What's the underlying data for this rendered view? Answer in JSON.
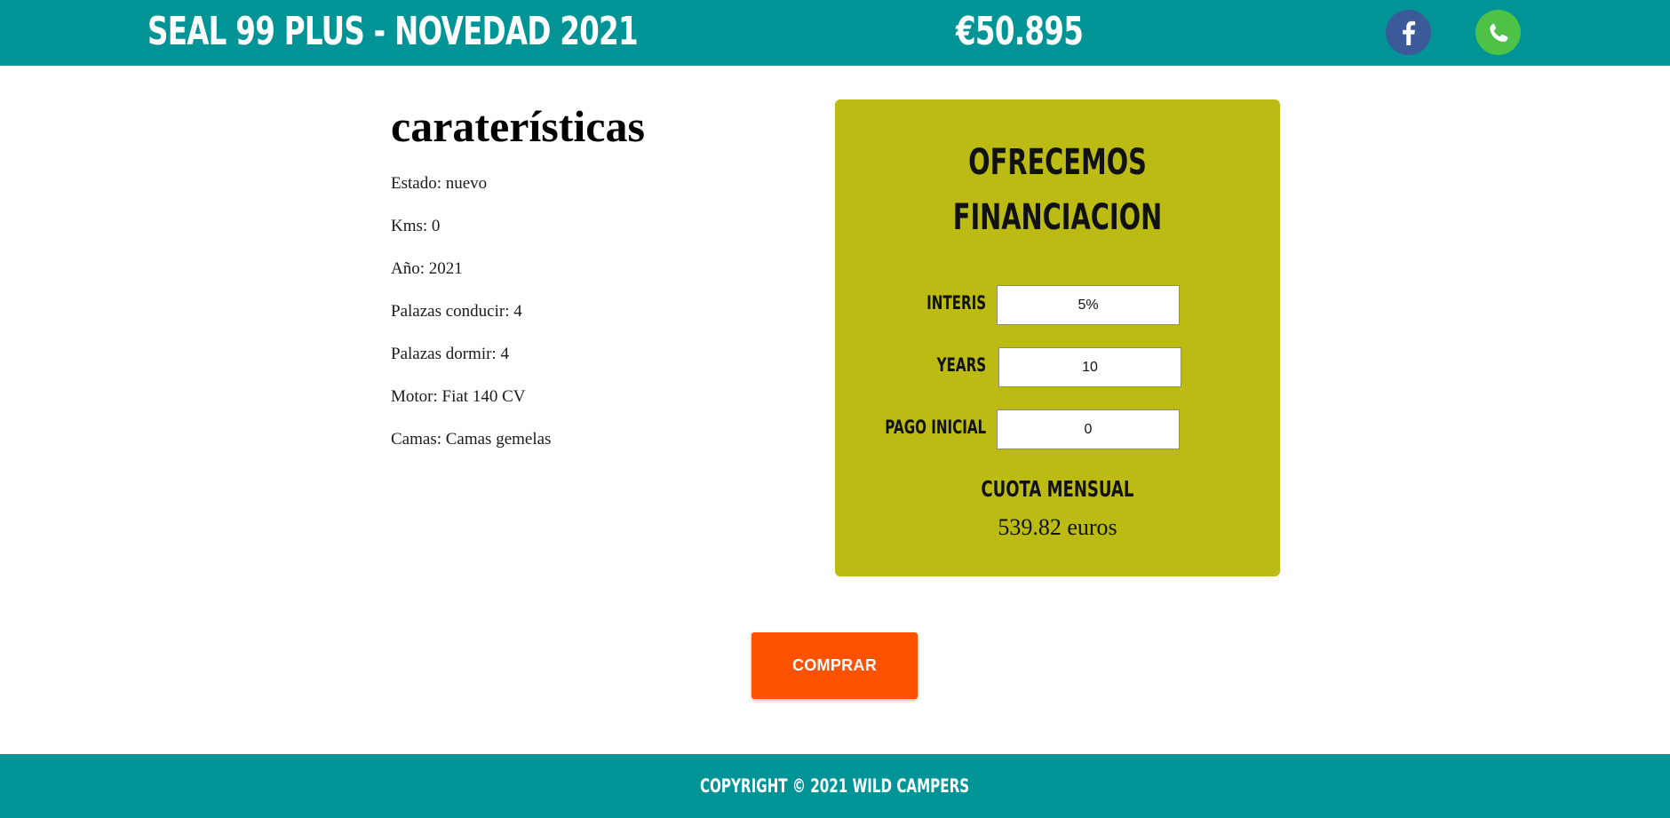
{
  "header": {
    "title": "SEAL 99 PLUS - NOVEDAD 2021",
    "price": "€50.895",
    "social": [
      {
        "name": "facebook-icon",
        "glyph": "f"
      },
      {
        "name": "whatsapp-icon",
        "glyph": "phone"
      }
    ]
  },
  "specs": {
    "title": "caraterísticas",
    "items": [
      "Estado: nuevo",
      "Kms: 0",
      "Año: 2021",
      "Palazas conducir: 4",
      "Palazas dormir: 4",
      "Motor: Fiat 140 CV",
      "Camas: Camas gemelas"
    ]
  },
  "finance": {
    "heading_line1": "OFRECEMOS",
    "heading_line2": "FINANCIACION",
    "interest_label": "INTERIS",
    "interest_value": "5%",
    "years_label": "YEARS",
    "years_value": "10",
    "down_payment_label": "PAGO INICIAL",
    "down_payment_value": "0",
    "monthly_label": "CUOTA MENSUAL",
    "monthly_value": "539.82 euros"
  },
  "buy_button": {
    "label": "COMPRAR"
  },
  "footer": {
    "copyright": "COPYRIGHT © 2021 WILD CAMPERS"
  },
  "colors": {
    "teal": "#009496",
    "olive": "#bbbb13",
    "orange": "#ff5200",
    "facebook": "#3b5a9a",
    "whatsapp": "#4dc247"
  }
}
